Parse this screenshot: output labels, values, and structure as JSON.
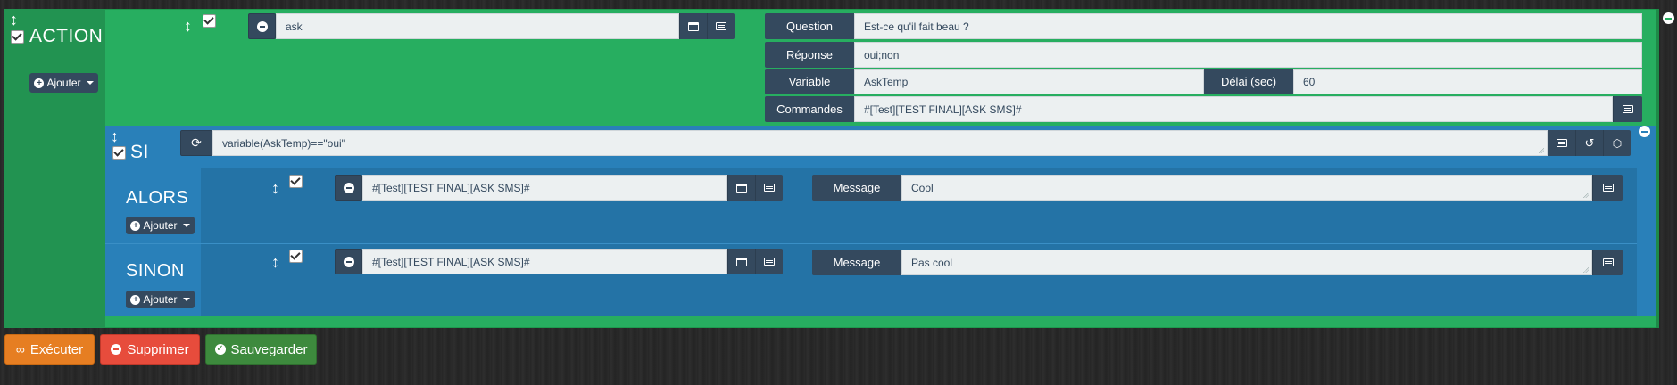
{
  "action": {
    "title": "ACTION",
    "add_label": "Ajouter",
    "command_value": "ask",
    "question_label": "Question",
    "question_value": "Est-ce qu'il fait beau ?",
    "reponse_label": "Réponse",
    "reponse_value": "oui;non",
    "variable_label": "Variable",
    "variable_value": "AskTemp",
    "delai_label": "Délai (sec)",
    "delai_value": "60",
    "commandes_label": "Commandes",
    "commandes_value": "#[Test][TEST FINAL][ASK SMS]#"
  },
  "si": {
    "title": "SI",
    "condition_value": "variable(AskTemp)==\"oui\""
  },
  "alors": {
    "title": "ALORS",
    "add_label": "Ajouter",
    "command_value": "#[Test][TEST FINAL][ASK SMS]#",
    "message_label": "Message",
    "message_value": "Cool"
  },
  "sinon": {
    "title": "SINON",
    "add_label": "Ajouter",
    "command_value": "#[Test][TEST FINAL][ASK SMS]#",
    "message_label": "Message",
    "message_value": "Pas cool"
  },
  "footer": {
    "execute_label": "Exécuter",
    "delete_label": "Supprimer",
    "save_label": "Sauvegarder"
  },
  "colors": {
    "action_green": "#27ae60",
    "si_blue": "#2980b9",
    "dark_button": "#34495e",
    "execute_orange": "#e67e22",
    "delete_red": "#e74c3c",
    "save_green": "#3d8a3d"
  }
}
